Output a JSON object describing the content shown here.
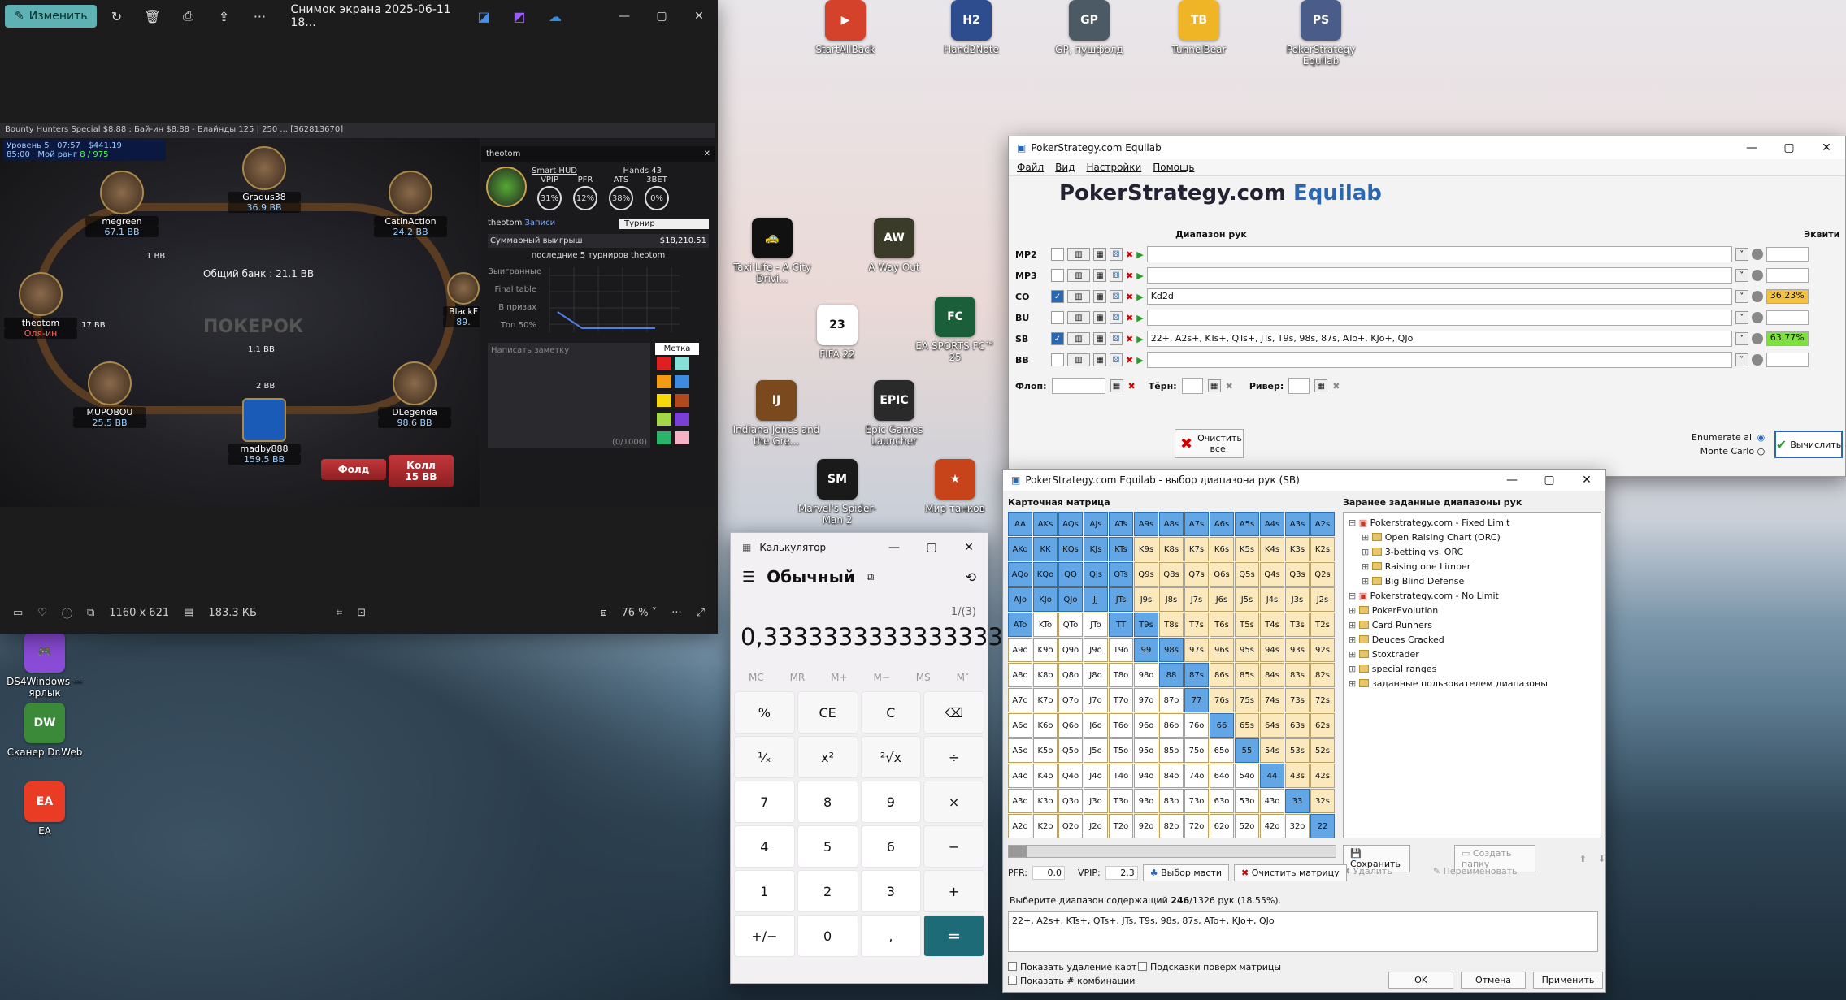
{
  "desktop": {
    "icons": [
      {
        "label": "StartAllBack",
        "color": "#d5422c",
        "glyph": "▶"
      },
      {
        "label": "Hand2Note",
        "color": "#2e4d8f",
        "glyph": "H2"
      },
      {
        "label": "GP, пушфолд",
        "color": "#4c5a66",
        "glyph": "GP"
      },
      {
        "label": "TunnelBear",
        "color": "#f0b526",
        "glyph": "TB"
      },
      {
        "label": "PokerStrategy Equilab",
        "color": "#4a5d8a",
        "glyph": "PS"
      },
      {
        "label": "Taxi Life - A City Drivi...",
        "color": "#111111",
        "glyph": "🚕"
      },
      {
        "label": "A Way Out",
        "color": "#3b3b2a",
        "glyph": "AW"
      },
      {
        "label": "FIFA 22",
        "color": "#ffffff",
        "glyph": "23"
      },
      {
        "label": "EA SPORTS FC™ 25",
        "color": "#1a5e3a",
        "glyph": "FC"
      },
      {
        "label": "Indiana Jones and the Gre...",
        "color": "#7a4a1e",
        "glyph": "IJ"
      },
      {
        "label": "Epic Games Launcher",
        "color": "#2a2a2a",
        "glyph": "EPIC"
      },
      {
        "label": "Marvel's Spider-Man 2",
        "color": "#1a1a1a",
        "glyph": "SM"
      },
      {
        "label": "Мир танков",
        "color": "#c7441a",
        "glyph": "★"
      },
      {
        "label": "DS4Windows — ярлык",
        "color": "#8a4bd6",
        "glyph": "🎮"
      },
      {
        "label": "Сканер Dr.Web",
        "color": "#3a8a3a",
        "glyph": "DW"
      },
      {
        "label": "EA",
        "color": "#ea3b25",
        "glyph": "EA"
      }
    ]
  },
  "photos": {
    "edit_label": "Изменить",
    "title": "Снимок экрана 2025-06-11 18...",
    "dimensions": "1160 x 621",
    "size": "183.3 КБ",
    "zoom": "76 %"
  },
  "poker": {
    "window_title": "Bounty Hunters Special $8.88 : Бай-ин $8.88 - Блайнды 125 | 250 ... [362813670]",
    "level": "Уровень 5",
    "time": "07:57",
    "prize": "$441.19",
    "rank_label": "Мой ранг",
    "rank": "8 / 975",
    "time2": "85:00",
    "pot": "Общий банк : 21.1 BB",
    "logo": "ПОКЕРОК",
    "seats": [
      {
        "name": "megreen",
        "stack": "67.1 BB"
      },
      {
        "name": "Gradus38",
        "stack": "36.9 BB"
      },
      {
        "name": "CatinAction",
        "stack": "24.2 BB"
      },
      {
        "name": "theotom",
        "stack": "Оля-ин"
      },
      {
        "name": "MUPOBOU",
        "stack": "25.5 BB"
      },
      {
        "name": "madby888",
        "stack": "159.5 BB"
      },
      {
        "name": "DLegenda",
        "stack": "98.6 BB"
      },
      {
        "name": "BlackF",
        "stack": "89."
      }
    ],
    "bets": {
      "b1": "1 BB",
      "b2": "17 BB",
      "b3": "1.1 BB",
      "b4": "2 BB"
    },
    "fold_label": "Фолд",
    "call_label": "Колл",
    "call_amount": "15 BB",
    "hud": {
      "player": "theotom",
      "records": "Записи",
      "smart_hud": "Smart HUD",
      "hands": "Hands 43",
      "stats": [
        {
          "label": "VPIP",
          "value": "31%"
        },
        {
          "label": "PFR",
          "value": "12%"
        },
        {
          "label": "ATS",
          "value": "38%"
        },
        {
          "label": "3BET",
          "value": "0%"
        }
      ],
      "mode": "Турнир",
      "winnings_label": "Суммарный выигрыш",
      "winnings": "$18,210.51",
      "last5": "последние 5 турниров theotom",
      "rows": [
        "Выигранные",
        "Final table",
        "В призах",
        "Топ 50%"
      ],
      "note_placeholder": "Написать заметку",
      "mark_label": "Метка",
      "note_count": "(0/1000)",
      "swatches": [
        "#e02020",
        "#86e0d8",
        "#f39c12",
        "#3c8be0",
        "#f5d90a",
        "#b2481e",
        "#a4d64a",
        "#7a3fd6",
        "#2cb36a",
        "#f3b3c5"
      ]
    }
  },
  "equilab": {
    "title": "PokerStrategy.com Equilab",
    "menu": [
      "Файл",
      "Вид",
      "Настройки",
      "Помощь"
    ],
    "brand": "PokerStrategy.com",
    "brand_suffix": "Equilab",
    "range_header": "Диапазон рук",
    "equity_header": "Эквити",
    "rows": [
      {
        "pos": "MP2",
        "range": "",
        "equity": "",
        "checked": false
      },
      {
        "pos": "MP3",
        "range": "",
        "equity": "",
        "checked": false
      },
      {
        "pos": "CO",
        "range": "Kd2d",
        "equity": "36.23%",
        "checked": true,
        "color": "#f6c23e"
      },
      {
        "pos": "BU",
        "range": "",
        "equity": "",
        "checked": false
      },
      {
        "pos": "SB",
        "range": "22+, A2s+, KTs+, QTs+, JTs, T9s, 98s, 87s, ATo+, KJo+, QJo",
        "equity": "63.77%",
        "checked": true,
        "color": "#7fe23a"
      },
      {
        "pos": "BB",
        "range": "",
        "equity": "",
        "checked": false
      }
    ],
    "flop_label": "Флоп:",
    "turn_label": "Тёрн:",
    "river_label": "Ривер:",
    "clear_all": "Очистить все",
    "enumerate": "Enumerate all",
    "monte_carlo": "Monte Carlo",
    "calculate": "Вычислить"
  },
  "range": {
    "title": "PokerStrategy.com Equilab - выбор диапазона рук (SB)",
    "matrix_label": "Карточная матрица",
    "presets_label": "Заранее заданные диапазоны рук",
    "selected": [
      "AA",
      "KK",
      "QQ",
      "JJ",
      "TT",
      "99",
      "88",
      "77",
      "66",
      "55",
      "44",
      "33",
      "22",
      "AKs",
      "AQs",
      "AJs",
      "ATs",
      "A9s",
      "A8s",
      "A7s",
      "A6s",
      "A5s",
      "A4s",
      "A3s",
      "A2s",
      "KQs",
      "KJs",
      "KTs",
      "QJs",
      "QTs",
      "JTs",
      "T9s",
      "98s",
      "87s",
      "AKo",
      "AQo",
      "AJo",
      "ATo",
      "KQo",
      "KJo",
      "QJo"
    ],
    "tree": [
      {
        "label": "Pokerstrategy.com - Fixed Limit",
        "level": 0,
        "root": true
      },
      {
        "label": "Open Raising Chart (ORC)",
        "level": 1
      },
      {
        "label": "3-betting vs. ORC",
        "level": 1
      },
      {
        "label": "Raising one Limper",
        "level": 1
      },
      {
        "label": "Big Blind Defense",
        "level": 1
      },
      {
        "label": "Pokerstrategy.com - No Limit",
        "level": 0,
        "root": true
      },
      {
        "label": "PokerEvolution",
        "level": 0
      },
      {
        "label": "Card Runners",
        "level": 0
      },
      {
        "label": "Deuces Cracked",
        "level": 0
      },
      {
        "label": "Stoxtrader",
        "level": 0
      },
      {
        "label": "special ranges",
        "level": 0
      },
      {
        "label": "заданные пользователем диапазоны",
        "level": 0
      }
    ],
    "save": "Сохранить",
    "new_folder": "Создать папку",
    "delete": "Удалить",
    "rename": "Переименовать",
    "pfr_label": "PFR:",
    "pfr": "0.0",
    "vpip_label": "VPIP:",
    "vpip": "2.3",
    "suit_select": "Выбор масти",
    "clear_matrix": "Очистить матрицу",
    "summary_prefix": "Выберите диапазон содержащий",
    "summary_count": "246",
    "summary_suffix": "/1326 рук (18.55%).",
    "range_text": "22+, A2s+, KTs+, QTs+, JTs, T9s, 98s, 87s, ATo+, KJo+, QJo",
    "show_removal": "Показать удаление карт",
    "show_combos": "Показать # комбинации",
    "tooltips": "Подсказки поверх матрицы",
    "ok": "OK",
    "cancel": "Отмена",
    "apply": "Применить"
  },
  "calculator": {
    "title": "Калькулятор",
    "mode": "Обычный",
    "expression": "1/(3)",
    "display": "0,3333333333333333",
    "memory": [
      "MC",
      "MR",
      "M+",
      "M−",
      "MS",
      "M˅"
    ],
    "keys": [
      "%",
      "CE",
      "C",
      "⌫",
      "¹⁄ₓ",
      "x²",
      "²√x",
      "÷",
      "7",
      "8",
      "9",
      "×",
      "4",
      "5",
      "6",
      "−",
      "1",
      "2",
      "3",
      "+",
      "+/−",
      "0",
      ",",
      "="
    ]
  }
}
